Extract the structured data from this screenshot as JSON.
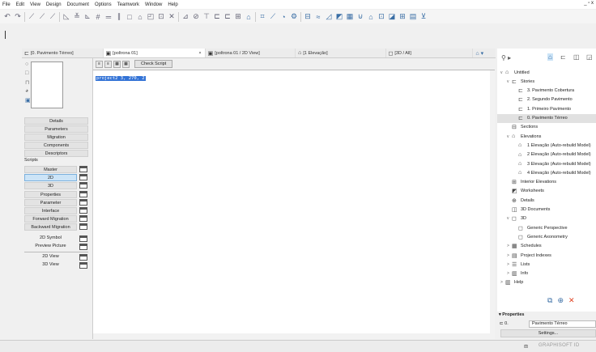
{
  "menu": [
    "File",
    "Edit",
    "View",
    "Design",
    "Document",
    "Options",
    "Teamwork",
    "Window",
    "Help"
  ],
  "window_controls": "_ ▫ x",
  "toolbar_icons": [
    "↶",
    "↷",
    "|",
    "⟋",
    "⟋",
    "⟋",
    "|",
    "◺",
    "≚",
    "⊾",
    "#",
    "═",
    "∥",
    "□",
    "⌂",
    "◰",
    "⊡",
    "✕",
    "|",
    "⊿",
    "⊘",
    "⊤",
    "⊏",
    "⊏",
    "⊞",
    "⌂",
    "|",
    "⌗",
    "⟋",
    "◔",
    "⚙",
    "|",
    "⊟",
    "≈",
    "◿",
    "◩",
    "▦",
    "⊍",
    "⌂",
    "⊡",
    "◪",
    "⊞",
    "▤",
    "⊻"
  ],
  "tabs": [
    {
      "icon": "floor-plan-icon",
      "label": "[0. Pavimento Térreo]"
    },
    {
      "icon": "gdl-object-icon",
      "label": "[poltrona 01]",
      "close": "×",
      "active": true
    },
    {
      "icon": "gdl-2d-icon",
      "label": "[poltrona 01 / 2D View]"
    },
    {
      "icon": "elevation-icon",
      "label": "[1 Elevação]"
    },
    {
      "icon": "3d-icon",
      "label": "[3D / All]"
    }
  ],
  "editor": {
    "check_script": "Check Script",
    "code": "project2 3, 270, 2"
  },
  "left_panel": {
    "sections": [
      "Details",
      "Parameters",
      "Migration",
      "Components",
      "Descriptors"
    ],
    "scripts_label": "Scripts",
    "scripts": [
      "Master",
      "2D",
      "3D",
      "Properties",
      "Parameter",
      "Interface",
      "Forward Migration",
      "Backward Migration"
    ],
    "selected_script": "2D",
    "extras": [
      "2D Symbol",
      "Preview Picture"
    ],
    "views": [
      "2D View",
      "3D View"
    ]
  },
  "navigator": {
    "tree": [
      {
        "label": "Untitled",
        "level": 0,
        "arrow": "v",
        "icon": "⌂"
      },
      {
        "label": "Stories",
        "level": 1,
        "arrow": "v",
        "icon": "⊏"
      },
      {
        "label": "3. Pavimento Cobertura",
        "level": 2,
        "icon": "⊏"
      },
      {
        "label": "2. Segundo Pavimento",
        "level": 2,
        "icon": "⊏"
      },
      {
        "label": "1. Primeiro Pavimento",
        "level": 2,
        "icon": "⊏"
      },
      {
        "label": "0. Pavimento Térreo",
        "level": 2,
        "icon": "⊏",
        "selected": true
      },
      {
        "label": "Sections",
        "level": 1,
        "icon": "⊟"
      },
      {
        "label": "Elevations",
        "level": 1,
        "arrow": "v",
        "icon": "⌂"
      },
      {
        "label": "1 Elevação (Auto-rebuild Model)",
        "level": 2,
        "icon": "⌂"
      },
      {
        "label": "2 Elevação (Auto-rebuild Model)",
        "level": 2,
        "icon": "⌂"
      },
      {
        "label": "3 Elevação (Auto-rebuild Model)",
        "level": 2,
        "icon": "⌂"
      },
      {
        "label": "4 Elevação (Auto-rebuild Model)",
        "level": 2,
        "icon": "⌂"
      },
      {
        "label": "Interior Elevations",
        "level": 1,
        "icon": "⊞"
      },
      {
        "label": "Worksheets",
        "level": 1,
        "icon": "◩"
      },
      {
        "label": "Details",
        "level": 1,
        "icon": "⊕"
      },
      {
        "label": "3D Documents",
        "level": 1,
        "icon": "◫"
      },
      {
        "label": "3D",
        "level": 1,
        "arrow": "v",
        "icon": "◻"
      },
      {
        "label": "Generic Perspective",
        "level": 2,
        "icon": "◻"
      },
      {
        "label": "Generic Axonometry",
        "level": 2,
        "icon": "◻"
      },
      {
        "label": "Schedules",
        "level": 1,
        "arrow": ">",
        "icon": "▦"
      },
      {
        "label": "Project Indexes",
        "level": 1,
        "arrow": ">",
        "icon": "▤"
      },
      {
        "label": "Lists",
        "level": 1,
        "arrow": ">",
        "icon": "☰"
      },
      {
        "label": "Info",
        "level": 1,
        "arrow": ">",
        "icon": "▥"
      },
      {
        "label": "Help",
        "level": 0,
        "arrow": ">",
        "icon": "▥"
      }
    ]
  },
  "properties": {
    "header": "▾ Properties",
    "id": "0.",
    "value": "Pavimento Térreo",
    "settings": "Settings..."
  },
  "status": {
    "brand": "GRAPHISOFT ID"
  },
  "colors": {
    "selection": "#3373d6",
    "accent": "#3a6ea5",
    "close_red": "#e0401f"
  }
}
